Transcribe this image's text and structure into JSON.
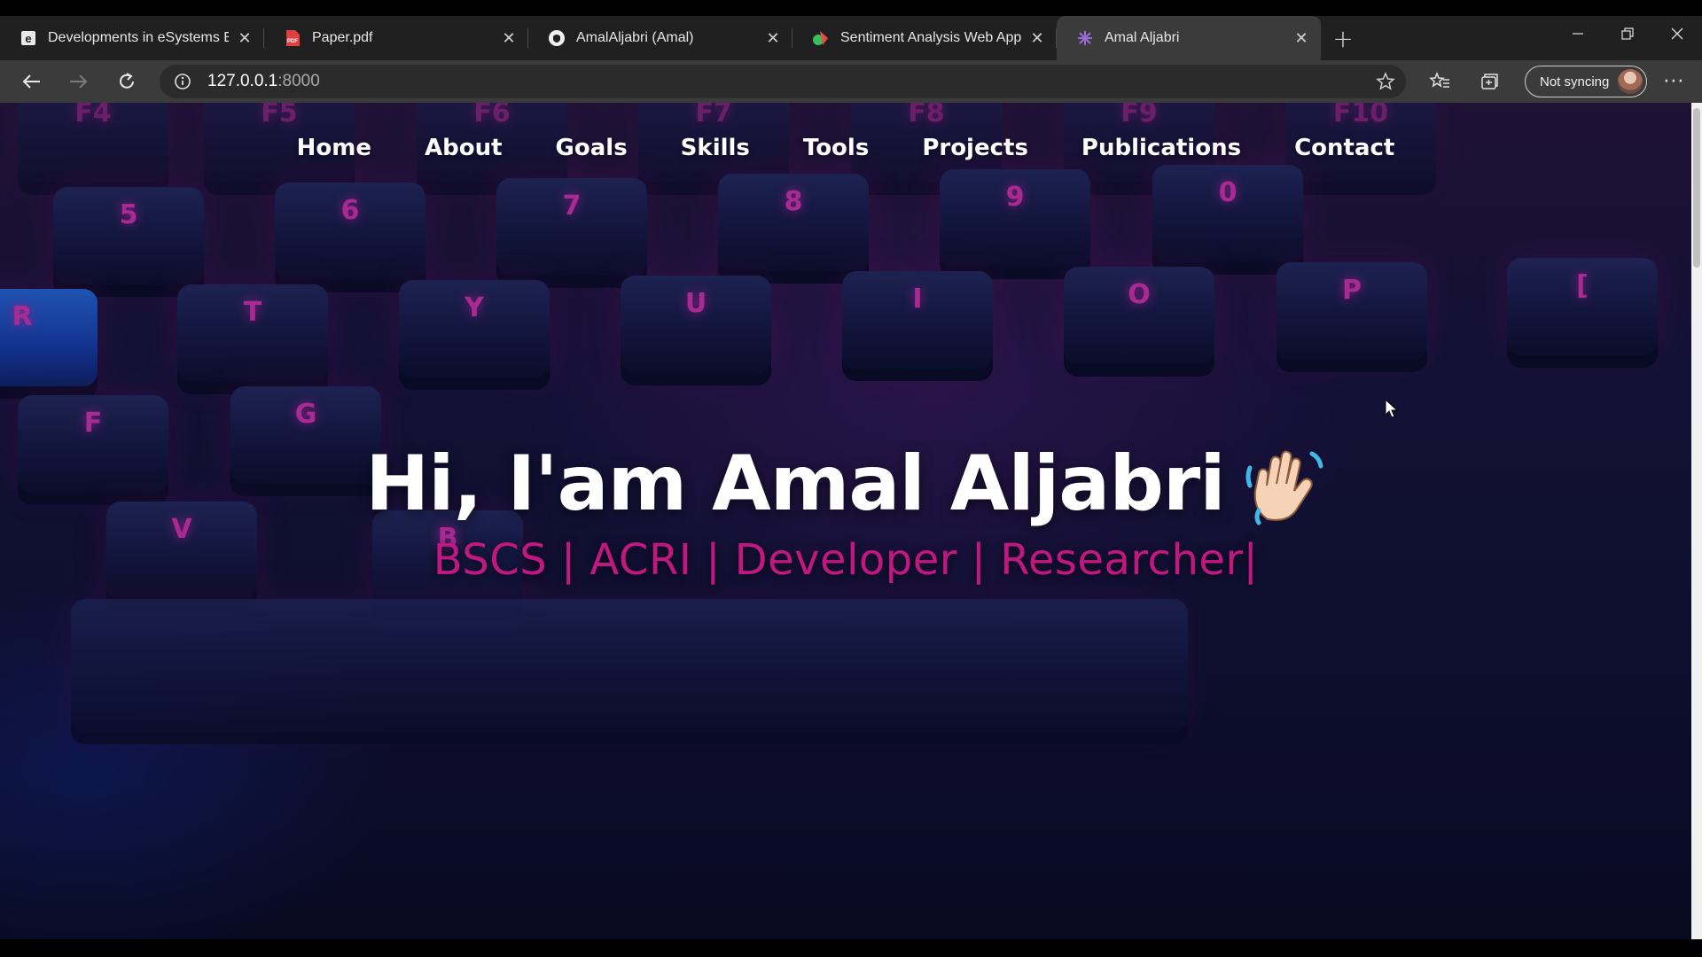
{
  "browser": {
    "tabs": [
      {
        "title": "Developments in eSystems Engir",
        "icon": "e-page-icon",
        "active": false
      },
      {
        "title": "Paper.pdf",
        "icon": "pdf-icon",
        "active": false
      },
      {
        "title": "AmalAljabri (Amal)",
        "icon": "github-icon",
        "active": false
      },
      {
        "title": "Sentiment Analysis Web App",
        "icon": "app-icon",
        "active": false
      },
      {
        "title": "Amal Aljabri",
        "icon": "site-icon",
        "active": true
      }
    ],
    "address": {
      "host": "127.0.0.1",
      "port": ":8000"
    },
    "sync_label": "Not syncing"
  },
  "page": {
    "nav": [
      "Home",
      "About",
      "Goals",
      "Skills",
      "Tools",
      "Projects",
      "Publications",
      "Contact"
    ],
    "hero_title": "Hi, I'am Amal Aljabri",
    "hero_subtitle": "BSCS | ACRI | Developer | Researcher",
    "caret": "|",
    "accent_color": "#c0187f",
    "keyboard_legends": [
      "F4",
      "F5",
      "F6",
      "F7",
      "F8",
      "F9",
      "F10",
      "5",
      "6",
      "7",
      "8",
      "9",
      "0",
      "R",
      "T",
      "Y",
      "U",
      "I",
      "O",
      "P",
      "[",
      "F",
      "G",
      "V",
      "B"
    ]
  }
}
